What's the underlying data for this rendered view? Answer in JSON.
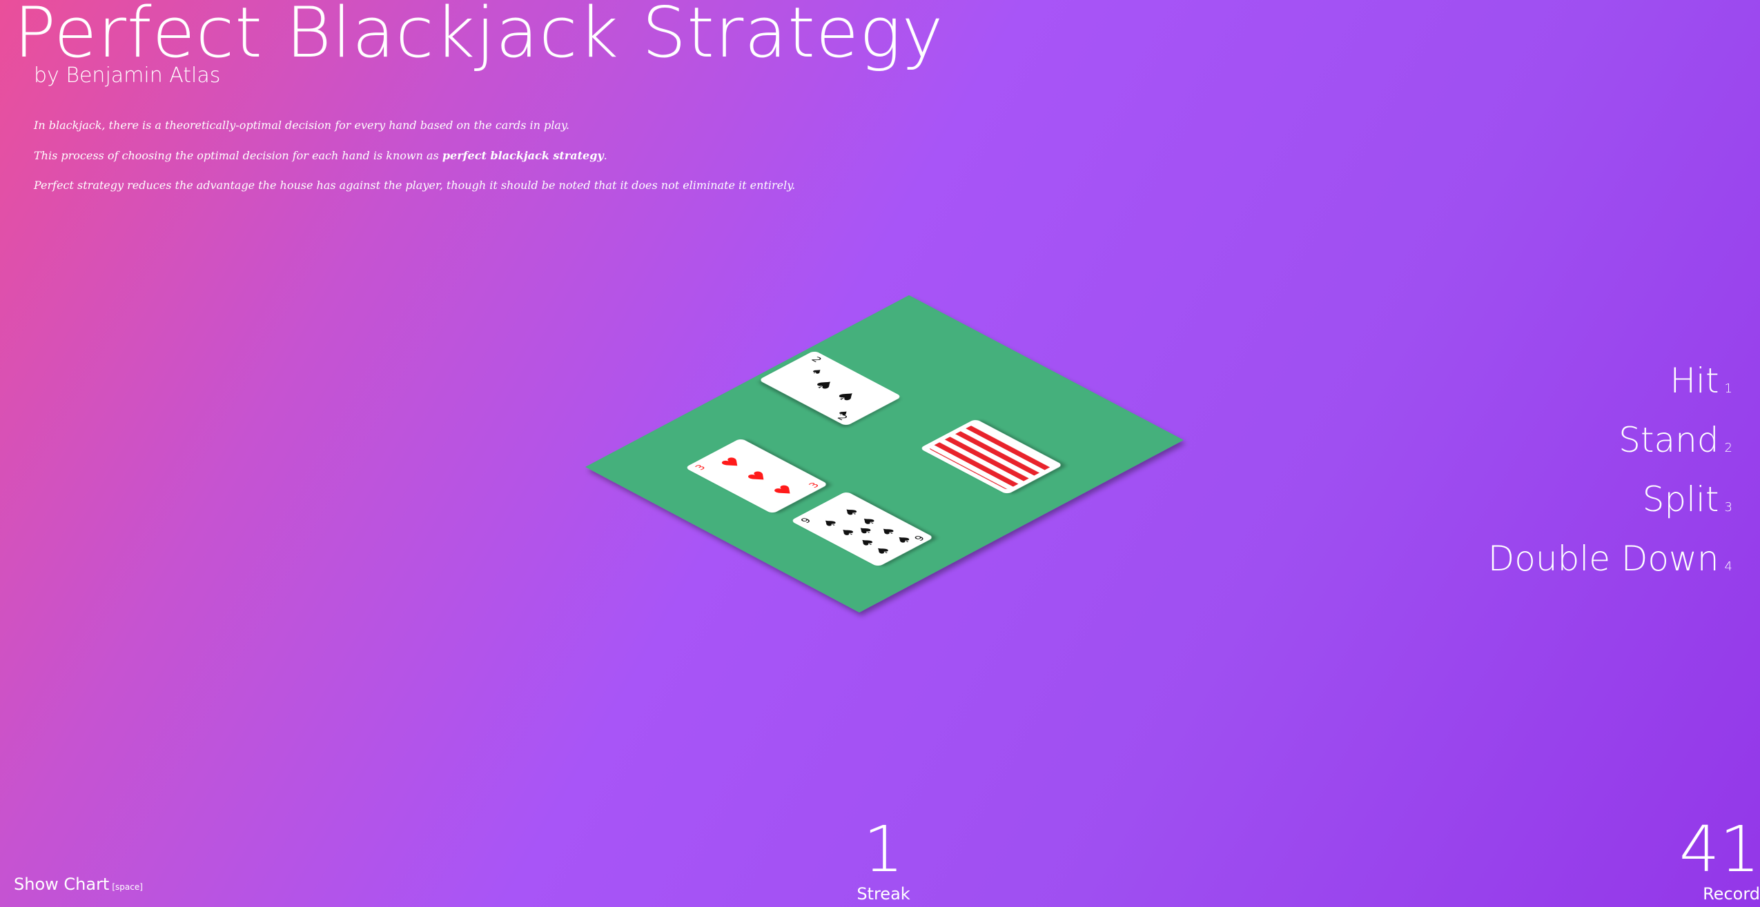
{
  "header": {
    "title": "Perfect Blackjack Strategy",
    "byline": "by Benjamin Atlas"
  },
  "intro": {
    "p1": "In blackjack, there is a theoretically-optimal decision for every hand based on the cards in play.",
    "p2_before": "This process of choosing the optimal decision for each hand is known as ",
    "p2_bold": "perfect blackjack strategy",
    "p2_after": ".",
    "p3": "Perfect strategy reduces the advantage the house has against the player, though it should be noted that it does not eliminate it entirely."
  },
  "actions": [
    {
      "label": "Hit",
      "key": "1"
    },
    {
      "label": "Stand",
      "key": "2"
    },
    {
      "label": "Split",
      "key": "3"
    },
    {
      "label": "Double Down",
      "key": "4"
    }
  ],
  "stats": {
    "streak_value": "1",
    "streak_label": "Streak",
    "record_value": "41",
    "record_label": "Record"
  },
  "footer": {
    "show_chart": "Show Chart",
    "show_chart_hint": "[space]"
  },
  "table": {
    "felt_color": "#44b07c",
    "card_back_color": "#e8232b",
    "cards": [
      {
        "id": "dealer-up",
        "rank": "2",
        "suit": "spades",
        "color": "#111111"
      },
      {
        "id": "dealer-hole",
        "face_down": true
      },
      {
        "id": "player-1",
        "rank": "3",
        "suit": "hearts",
        "color": "#ff1a1a"
      },
      {
        "id": "player-2",
        "rank": "9",
        "suit": "spades",
        "color": "#111111"
      }
    ]
  }
}
